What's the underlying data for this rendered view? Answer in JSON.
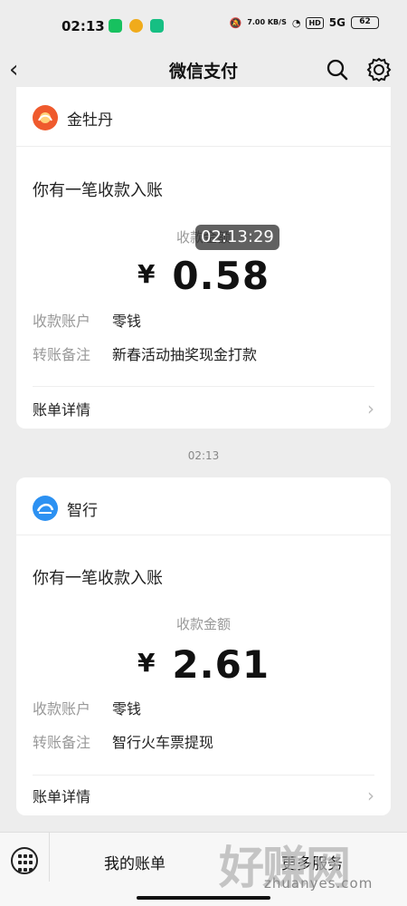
{
  "status_bar": {
    "time": "02:13",
    "network_speed": "7.00 KB/S",
    "hd_badge": "HD",
    "signal_label": "5G",
    "battery": "62"
  },
  "header": {
    "title": "微信支付",
    "back_icon": "back-chevron-icon",
    "search_icon": "search-icon",
    "settings_icon": "gear-icon"
  },
  "cards": [
    {
      "merchant": "金牡丹",
      "heading": "你有一笔收款入账",
      "amount_label": "收款金额",
      "currency": "¥",
      "amount": "0.58",
      "account_label": "收款账户",
      "account_value": "零钱",
      "remark_label": "转账备注",
      "remark_value": "新春活动抽奖现金打款",
      "detail_label": "账单详情"
    },
    {
      "merchant": "智行",
      "heading": "你有一笔收款入账",
      "amount_label": "收款金额",
      "currency": "¥",
      "amount": "2.61",
      "account_label": "收款账户",
      "account_value": "零钱",
      "remark_label": "转账备注",
      "remark_value": "智行火车票提现",
      "detail_label": "账单详情"
    }
  ],
  "overlay_time": "02:13:29",
  "message_time": "02:13",
  "bottom_bar": {
    "my_bills": "我的账单",
    "service": "更多服务"
  },
  "watermark": {
    "brand": "好赚网",
    "domain": "zhuanyes.com"
  },
  "colors": {
    "background": "#ededed",
    "card": "#ffffff",
    "secondary_text": "#999999",
    "merchant_orange": "#ef5a2d",
    "merchant_blue": "#2c91f2"
  }
}
